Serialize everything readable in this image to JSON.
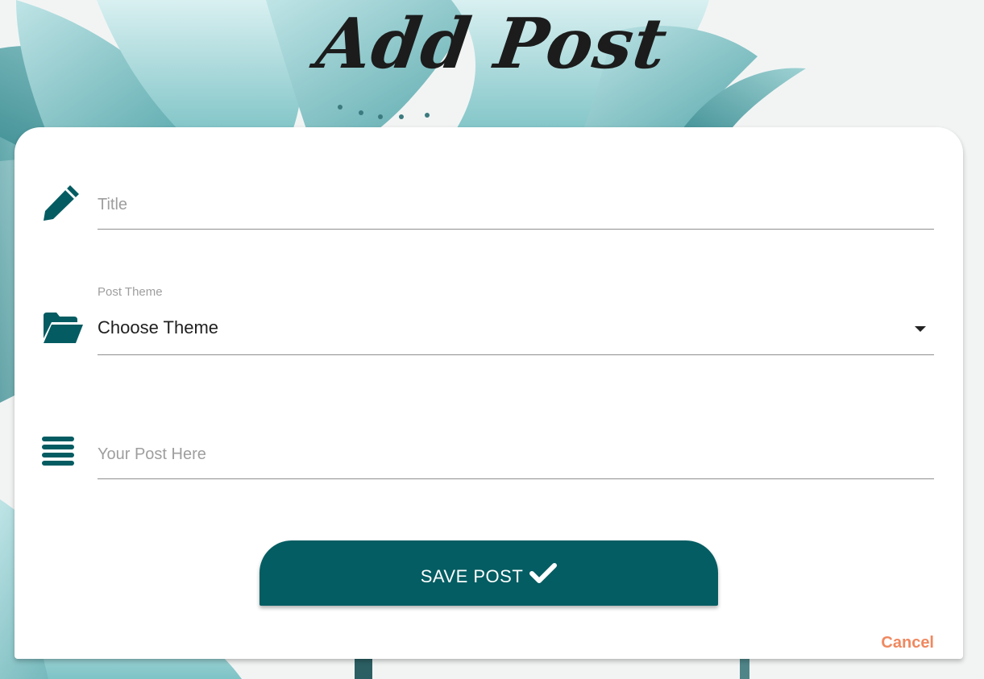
{
  "page": {
    "title": "Add Post"
  },
  "form": {
    "title_placeholder": "Title",
    "theme_label": "Post Theme",
    "theme_value": "Choose Theme",
    "post_placeholder": "Your Post Here",
    "save_label": "SAVE POST",
    "cancel_label": "Cancel"
  },
  "icons": {
    "title_icon": "pencil-icon",
    "theme_icon": "folder-open-icon",
    "post_icon": "align-justify-icon",
    "save_icon": "checkmark-icon",
    "theme_dropdown_icon": "caret-down-icon"
  },
  "colors": {
    "accent": "#035d62",
    "cancel": "#f0885f",
    "title_text": "#1c1c1c"
  }
}
